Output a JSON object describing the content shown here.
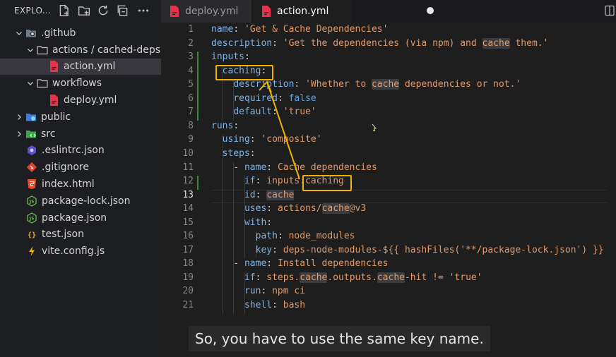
{
  "explorer": {
    "title": "EXPLO...",
    "tree": [
      {
        "label": ".github",
        "depth": 0,
        "type": "folder",
        "open": true,
        "icon": "github-folder-icon"
      },
      {
        "label": "actions / cached-deps",
        "depth": 1,
        "type": "folder",
        "open": true,
        "icon": "folder-icon"
      },
      {
        "label": "action.yml",
        "depth": 2,
        "type": "file",
        "icon": "yaml-file-icon",
        "selected": true
      },
      {
        "label": "workflows",
        "depth": 1,
        "type": "folder",
        "open": true,
        "icon": "folder-icon"
      },
      {
        "label": "deploy.yml",
        "depth": 2,
        "type": "file",
        "icon": "yaml-file-icon"
      },
      {
        "label": "public",
        "depth": 0,
        "type": "folder",
        "open": false,
        "icon": "public-folder-icon"
      },
      {
        "label": "src",
        "depth": 0,
        "type": "folder",
        "open": false,
        "icon": "src-folder-icon"
      },
      {
        "label": ".eslintrc.json",
        "depth": 0,
        "type": "file",
        "icon": "eslint-file-icon"
      },
      {
        "label": ".gitignore",
        "depth": 0,
        "type": "file",
        "icon": "git-file-icon"
      },
      {
        "label": "index.html",
        "depth": 0,
        "type": "file",
        "icon": "html-file-icon"
      },
      {
        "label": "package-lock.json",
        "depth": 0,
        "type": "file",
        "icon": "node-file-icon"
      },
      {
        "label": "package.json",
        "depth": 0,
        "type": "file",
        "icon": "node-file-icon"
      },
      {
        "label": "test.json",
        "depth": 0,
        "type": "file",
        "icon": "json-file-icon"
      },
      {
        "label": "vite.config.js",
        "depth": 0,
        "type": "file",
        "icon": "vite-file-icon"
      }
    ]
  },
  "tabs": [
    {
      "label": "deploy.yml",
      "active": false
    },
    {
      "label": "action.yml",
      "active": true,
      "dirty": true
    }
  ],
  "editor": {
    "current_line": 13,
    "lines": [
      [
        [
          "k",
          "name"
        ],
        [
          "p",
          ": "
        ],
        [
          "s",
          "'Get & Cache Dependencies'"
        ]
      ],
      [
        [
          "k",
          "description"
        ],
        [
          "p",
          ": "
        ],
        [
          "s",
          "'Get the dependencies (via npm) and "
        ],
        [
          "sh",
          "cache"
        ],
        [
          "s",
          " them.'"
        ]
      ],
      [
        [
          "k",
          "inputs"
        ],
        [
          "p",
          ":"
        ]
      ],
      [
        [
          "p",
          "  "
        ],
        [
          "k",
          "caching"
        ],
        [
          "p",
          ":"
        ]
      ],
      [
        [
          "p",
          "    "
        ],
        [
          "k",
          "description"
        ],
        [
          "p",
          ": "
        ],
        [
          "s",
          "'Whether to "
        ],
        [
          "sh",
          "cache"
        ],
        [
          "s",
          " dependencies or not.'"
        ]
      ],
      [
        [
          "p",
          "    "
        ],
        [
          "k",
          "required"
        ],
        [
          "p",
          ": "
        ],
        [
          "kw",
          "false"
        ]
      ],
      [
        [
          "p",
          "    "
        ],
        [
          "k",
          "default"
        ],
        [
          "p",
          ": "
        ],
        [
          "s",
          "'true'"
        ]
      ],
      [
        [
          "k",
          "runs"
        ],
        [
          "p",
          ":"
        ]
      ],
      [
        [
          "p",
          "  "
        ],
        [
          "k",
          "using"
        ],
        [
          "p",
          ": "
        ],
        [
          "s",
          "'composite'"
        ]
      ],
      [
        [
          "p",
          "  "
        ],
        [
          "k",
          "steps"
        ],
        [
          "p",
          ":"
        ]
      ],
      [
        [
          "p",
          "    - "
        ],
        [
          "k",
          "name"
        ],
        [
          "p",
          ": "
        ],
        [
          "v",
          "Cache dependencies"
        ]
      ],
      [
        [
          "p",
          "      "
        ],
        [
          "k",
          "if"
        ],
        [
          "p",
          ": "
        ],
        [
          "v",
          "inputs.caching"
        ]
      ],
      [
        [
          "p",
          "      "
        ],
        [
          "k",
          "id"
        ],
        [
          "p",
          ": "
        ],
        [
          "vh",
          "cache"
        ]
      ],
      [
        [
          "p",
          "      "
        ],
        [
          "k",
          "uses"
        ],
        [
          "p",
          ": "
        ],
        [
          "v",
          "actions/"
        ],
        [
          "vh",
          "cache"
        ],
        [
          "v",
          "@v3"
        ]
      ],
      [
        [
          "p",
          "      "
        ],
        [
          "k",
          "with"
        ],
        [
          "p",
          ":"
        ]
      ],
      [
        [
          "p",
          "        "
        ],
        [
          "k",
          "path"
        ],
        [
          "p",
          ": "
        ],
        [
          "v",
          "node_modules"
        ]
      ],
      [
        [
          "p",
          "        "
        ],
        [
          "k",
          "key"
        ],
        [
          "p",
          ": "
        ],
        [
          "v",
          "deps-node-modules-${{ hashFiles('**/package-lock.json') }}"
        ]
      ],
      [
        [
          "p",
          "    - "
        ],
        [
          "k",
          "name"
        ],
        [
          "p",
          ": "
        ],
        [
          "v",
          "Install dependencies"
        ]
      ],
      [
        [
          "p",
          "      "
        ],
        [
          "k",
          "if"
        ],
        [
          "p",
          ": "
        ],
        [
          "v",
          "steps."
        ],
        [
          "vh",
          "cache"
        ],
        [
          "v",
          ".outputs."
        ],
        [
          "vh",
          "cache"
        ],
        [
          "v",
          "-hit != 'true'"
        ]
      ],
      [
        [
          "p",
          "      "
        ],
        [
          "k",
          "run"
        ],
        [
          "p",
          ": "
        ],
        [
          "v",
          "npm ci"
        ]
      ],
      [
        [
          "p",
          "      "
        ],
        [
          "k",
          "shell"
        ],
        [
          "p",
          ": "
        ],
        [
          "v",
          "bash"
        ]
      ]
    ]
  },
  "caption": "So, you have to use the same key name.",
  "colors": {
    "annotation": "#f2b200",
    "accent_red": "#e5334b"
  }
}
